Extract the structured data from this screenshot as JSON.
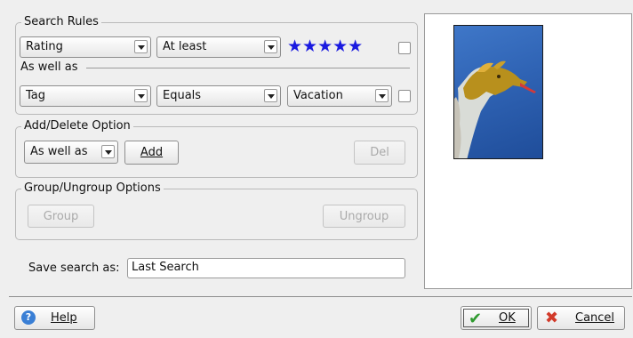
{
  "search_rules": {
    "title": "Search Rules",
    "rule1": {
      "field": "Rating",
      "operator": "At least",
      "value_stars": "★★★★★",
      "rating": 5,
      "star_color": "#1a1ae0"
    },
    "as_well_as_label": "As well as",
    "rule2": {
      "field": "Tag",
      "operator": "Equals",
      "value": "Vacation"
    }
  },
  "add_delete": {
    "title": "Add/Delete Option",
    "combo_value": "As well as",
    "add_label": "Add",
    "del_label": "Del"
  },
  "group_ungroup": {
    "title": "Group/Ungroup Options",
    "group_label": "Group",
    "ungroup_label": "Ungroup"
  },
  "save": {
    "label": "Save search as:",
    "value": "Last Search"
  },
  "buttons": {
    "help": "Help",
    "ok": "OK",
    "cancel": "Cancel"
  },
  "colors": {
    "help_icon": "#3a7fd5",
    "ok_icon": "#2f9a2f",
    "cancel_icon": "#d23a2a"
  }
}
